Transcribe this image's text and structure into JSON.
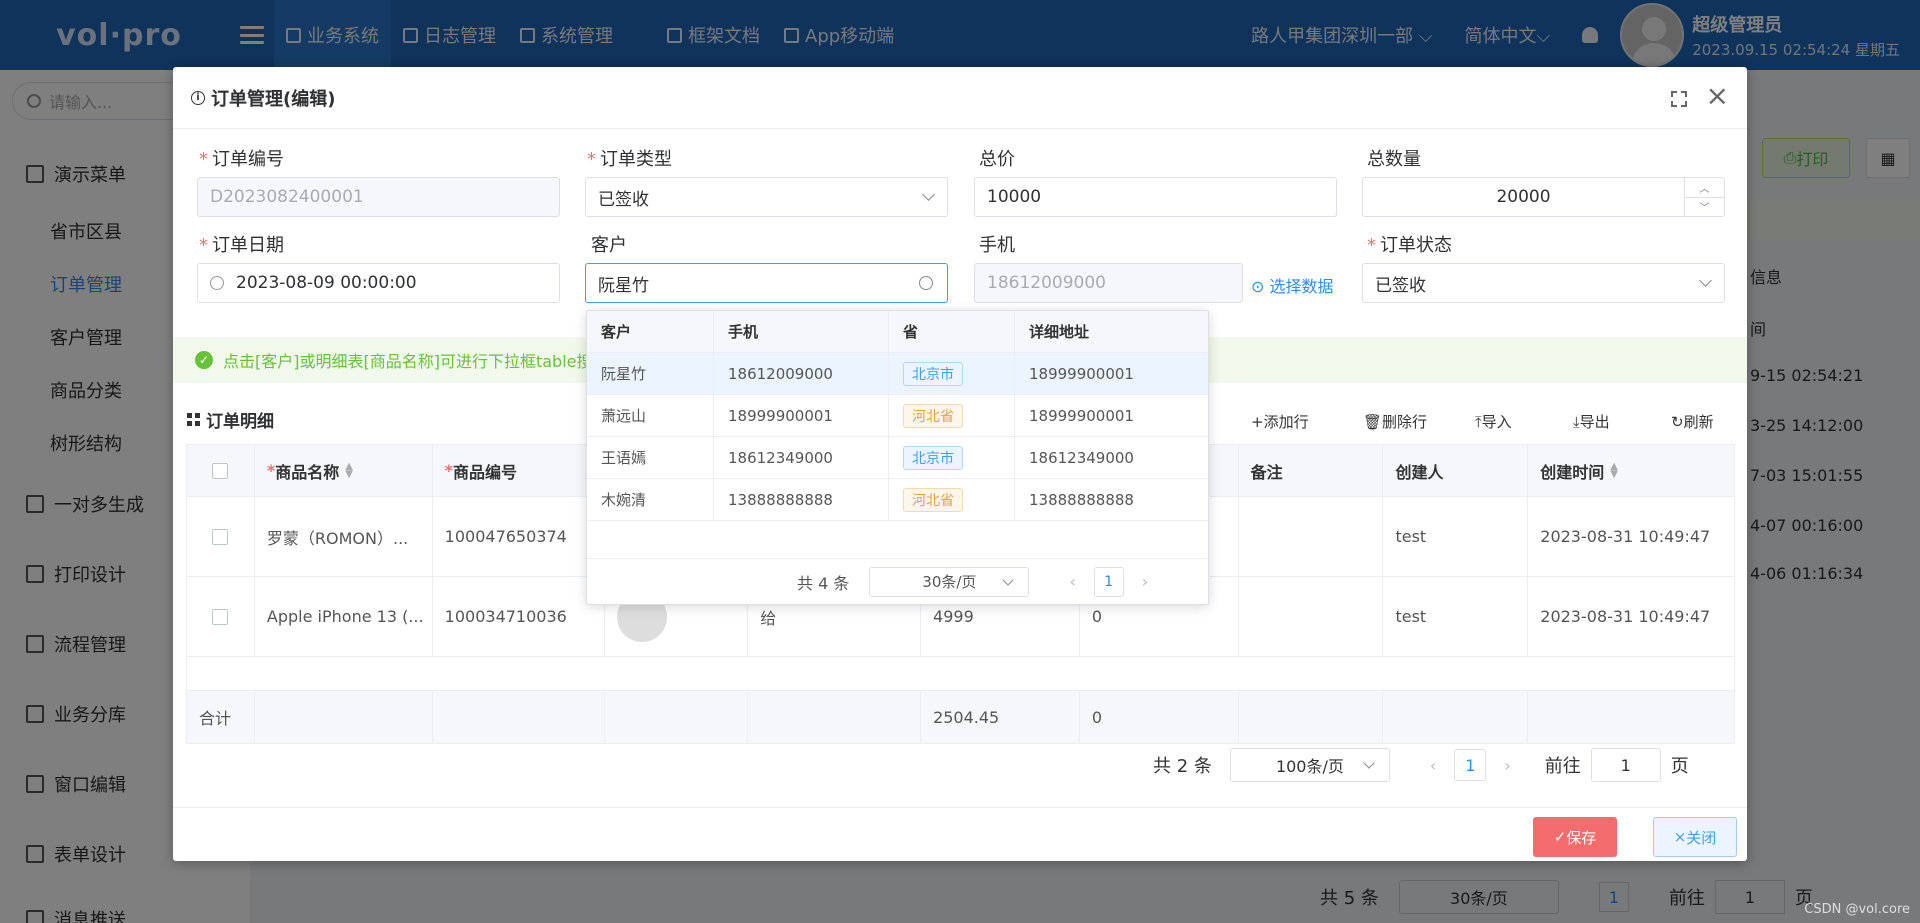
{
  "app": {
    "logo": "vol·pro",
    "nav": [
      "业务系统",
      "日志管理",
      "系统管理",
      "框架文档",
      "App移动端"
    ],
    "org": "路人甲集团深圳一部",
    "lang": "简体中文",
    "user": {
      "name": "超级管理员",
      "time": "2023.09.15 02:54:24 星期五"
    }
  },
  "sidebar": {
    "search_placeholder": "请输入...",
    "groups": [
      {
        "label": "演示菜单",
        "items": [
          "省市区县",
          "订单管理",
          "客户管理",
          "商品分类",
          "树形结构"
        ]
      },
      {
        "label": "一对多生成"
      },
      {
        "label": "打印设计"
      },
      {
        "label": "流程管理"
      },
      {
        "label": "业务分库"
      },
      {
        "label": "窗口编辑"
      },
      {
        "label": "表单设计"
      },
      {
        "label": "消息推送"
      }
    ]
  },
  "background": {
    "print": "打印",
    "col_info": "信息",
    "col_time": "间",
    "rows": [
      "9-15 02:54:21",
      "3-25 14:12:00",
      "7-03 15:01:55",
      "4-07 00:16:00",
      "4-06 01:16:34"
    ],
    "pager": {
      "total": "共 5 条",
      "size": "30条/页",
      "page": "1",
      "goto": "前往",
      "goto_val": "1",
      "page_unit": "页"
    }
  },
  "dialog": {
    "title": "订单管理(编辑)",
    "fields": {
      "order_no": {
        "label": "订单编号",
        "value": "D2023082400001"
      },
      "order_type": {
        "label": "订单类型",
        "value": "已签收"
      },
      "total_price": {
        "label": "总价",
        "value": "10000"
      },
      "total_qty": {
        "label": "总数量",
        "value": "20000"
      },
      "order_date": {
        "label": "订单日期",
        "value": "2023-08-09 00:00:00"
      },
      "customer": {
        "label": "客户",
        "value": "阮星竹"
      },
      "phone": {
        "label": "手机",
        "value": "18612009000"
      },
      "select_data": "选择数据",
      "order_status": {
        "label": "订单状态",
        "value": "已签收"
      }
    },
    "tip": "点击[客户]或明细表[商品名称]可进行下拉框table搜",
    "detail": {
      "title": "订单明细",
      "tools": [
        "添加行",
        "删除行",
        "导入",
        "导出",
        "刷新"
      ],
      "columns": [
        "商品名称",
        "商品编号",
        "",
        "",
        "",
        "",
        "备注",
        "创建人",
        "创建时间"
      ],
      "rows": [
        {
          "name": "罗蒙（ROMON）...",
          "code": "100047650374",
          "extra": "",
          "price": "",
          "qty": "",
          "remark": "",
          "creator": "test",
          "time": "2023-08-31 10:49:47"
        },
        {
          "name": "Apple iPhone 13 (...",
          "code": "100034710036",
          "extra": "给",
          "price": "4999",
          "qty": "0",
          "remark": "",
          "creator": "test",
          "time": "2023-08-31 10:49:47"
        }
      ],
      "footer": {
        "label": "合计",
        "price": "2504.45",
        "qty": "0"
      },
      "pager": {
        "total": "共 2 条",
        "size": "100条/页",
        "page": "1",
        "goto": "前往",
        "goto_val": "1",
        "page_unit": "页"
      }
    },
    "buttons": {
      "save": "保存",
      "close": "关闭"
    }
  },
  "popup": {
    "columns": [
      "客户",
      "手机",
      "省",
      "详细地址"
    ],
    "rows": [
      {
        "name": "阮星竹",
        "phone": "18612009000",
        "province": "北京市",
        "addr": "18999900001",
        "color": "blue"
      },
      {
        "name": "萧远山",
        "phone": "18999900001",
        "province": "河北省",
        "addr": "18999900001",
        "color": "orange"
      },
      {
        "name": "王语嫣",
        "phone": "18612349000",
        "province": "北京市",
        "addr": "18612349000",
        "color": "blue"
      },
      {
        "name": "木婉清",
        "phone": "13888888888",
        "province": "河北省",
        "addr": "13888888888",
        "color": "orange"
      }
    ],
    "pager": {
      "total": "共 4 条",
      "size": "30条/页",
      "page": "1"
    }
  },
  "watermark": "CSDN @vol.core",
  "colors": {
    "brand": "#1f67b7",
    "link": "#2d8cf0",
    "danger": "#f56c6c",
    "success": "#67c23a"
  }
}
